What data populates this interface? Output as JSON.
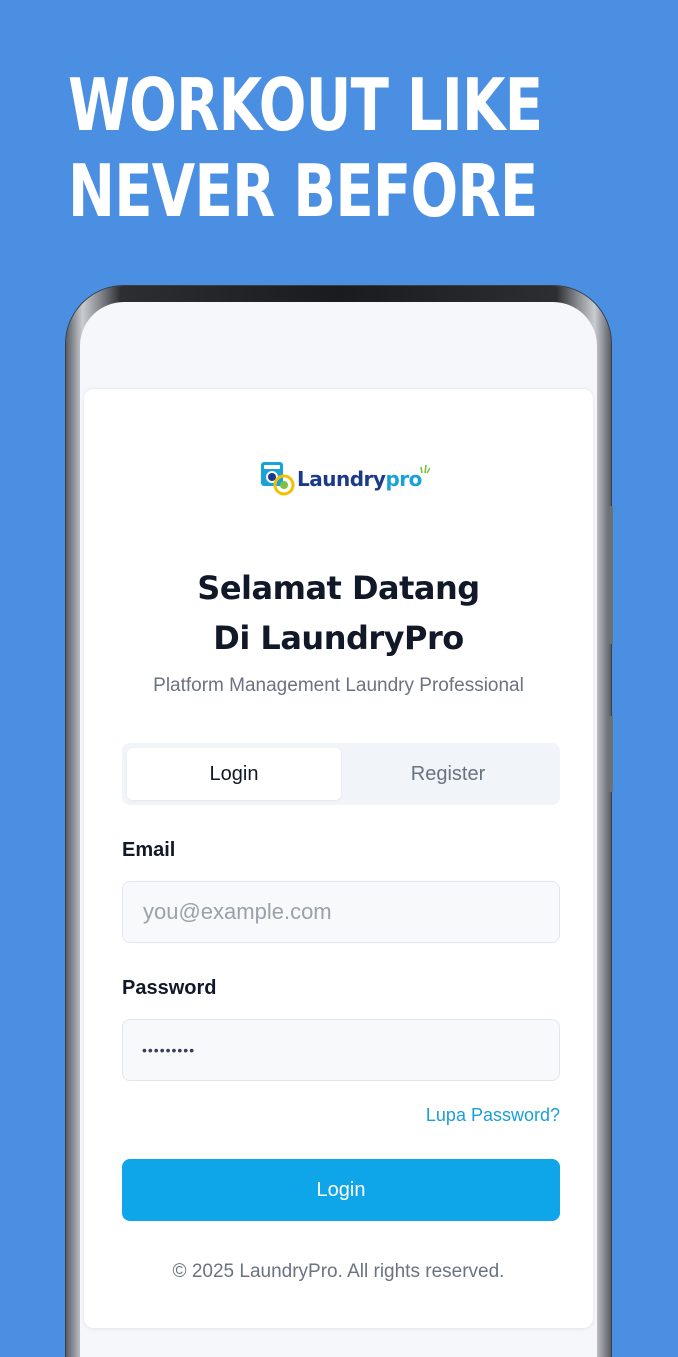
{
  "promo": {
    "line1": "WORKOUT LIKE",
    "line2": "NEVER BEFORE"
  },
  "app": {
    "logo_main": "Laundry",
    "logo_accent": "pro",
    "title": "Selamat Datang Di LaundryPro",
    "subtitle": "Platform Management Laundry Professional",
    "tabs": [
      {
        "label": "Login",
        "active": true
      },
      {
        "label": "Register",
        "active": false
      }
    ],
    "email": {
      "label": "Email",
      "placeholder": "you@example.com",
      "value": ""
    },
    "password": {
      "label": "Password",
      "masked_value": "•••••••••"
    },
    "forgot_label": "Lupa Password?",
    "login_button": "Login",
    "footer": "© 2025 LaundryPro. All rights reserved."
  },
  "colors": {
    "background": "#4a8fe2",
    "accent": "#0ea5e9",
    "link": "#1a9fd6",
    "logo_navy": "#1c3a8c"
  }
}
